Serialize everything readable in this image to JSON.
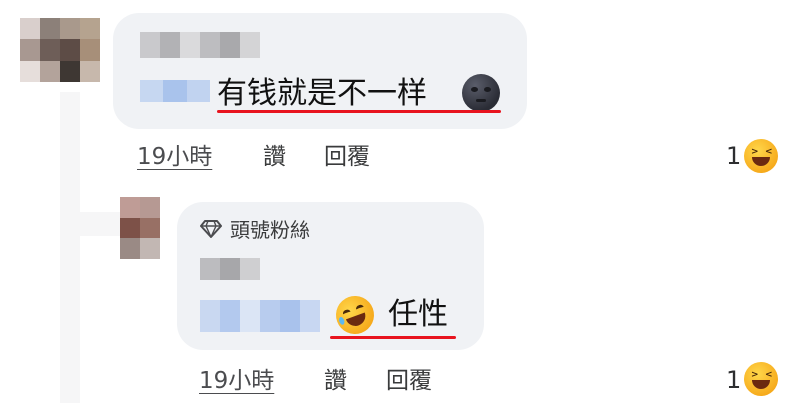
{
  "comment1": {
    "text": "有钱就是不一样",
    "emoji_icon": "new-moon-face-icon",
    "time": "19小時",
    "like_label": "讚",
    "reply_label": "回覆",
    "reaction_count": "1",
    "reaction_icon": "laughing-face-icon"
  },
  "comment2": {
    "badge": "頭號粉絲",
    "badge_icon": "diamond-icon",
    "emoji_icon": "rolling-on-floor-laughing-icon",
    "text": "任性",
    "time": "19小時",
    "like_label": "讚",
    "reply_label": "回覆",
    "reaction_count": "1",
    "reaction_icon": "laughing-face-icon"
  },
  "colors": {
    "bubble": "#f0f2f5",
    "underline": "#e8141e",
    "reaction_yellow": "#fcc21b"
  }
}
